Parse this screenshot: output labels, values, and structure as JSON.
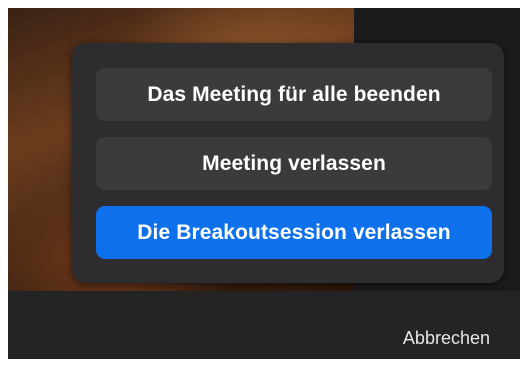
{
  "dialog": {
    "buttons": [
      {
        "label": "Das Meeting für alle beenden",
        "style": "secondary"
      },
      {
        "label": "Meeting verlassen",
        "style": "secondary"
      },
      {
        "label": "Die Breakoutsession verlassen",
        "style": "primary"
      }
    ],
    "cancel_label": "Abbrechen"
  },
  "colors": {
    "primary": "#0e71eb",
    "secondary": "#3b3b3d",
    "panel": "#2d2d2f"
  }
}
